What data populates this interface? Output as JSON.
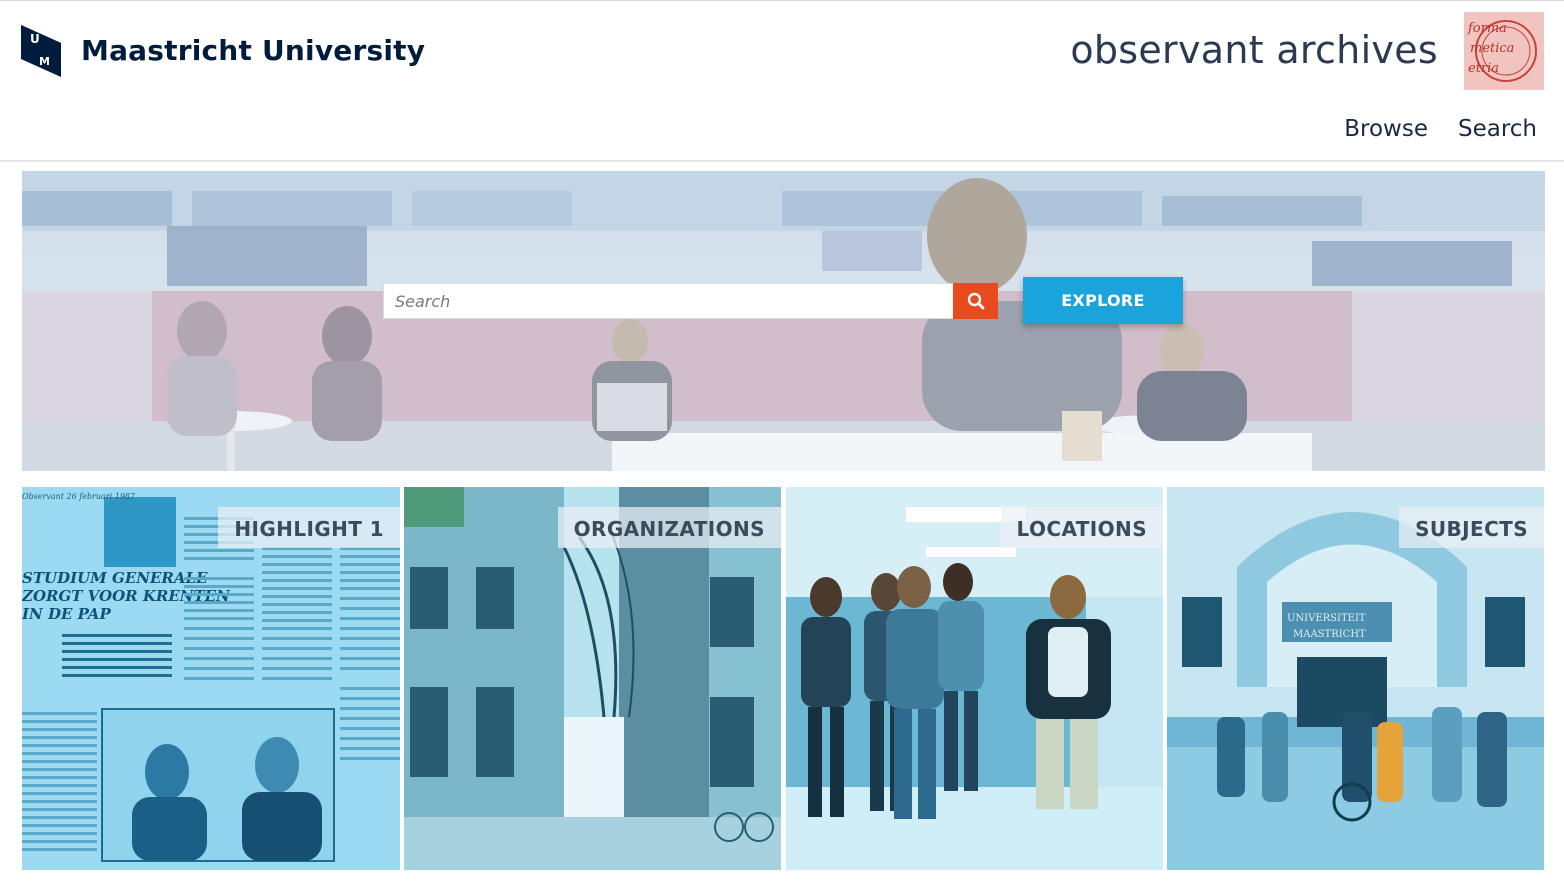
{
  "header": {
    "brand_name": "Maastricht University",
    "site_title": "observant archives",
    "logo_icon": "um-logo-icon",
    "stamp_icon": "archive-stamp-icon",
    "stamp_text": "forma metica etria"
  },
  "nav": {
    "items": [
      {
        "label": "Browse"
      },
      {
        "label": "Search"
      }
    ]
  },
  "hero": {
    "search_placeholder": "Search",
    "search_icon": "search-icon",
    "explore_label": "EXPLORE"
  },
  "tiles": [
    {
      "label": "HIGHLIGHT 1",
      "image": "newspaper-clipping-image"
    },
    {
      "label": "ORGANIZATIONS",
      "image": "building-alley-image"
    },
    {
      "label": "LOCATIONS",
      "image": "students-corridor-image"
    },
    {
      "label": "SUBJECTS",
      "image": "university-entrance-image"
    }
  ],
  "colors": {
    "brand_dark": "#001c3d",
    "accent_orange": "#e8491d",
    "accent_blue": "#1ba3dc",
    "tile_tint": "#4aa9c9"
  }
}
